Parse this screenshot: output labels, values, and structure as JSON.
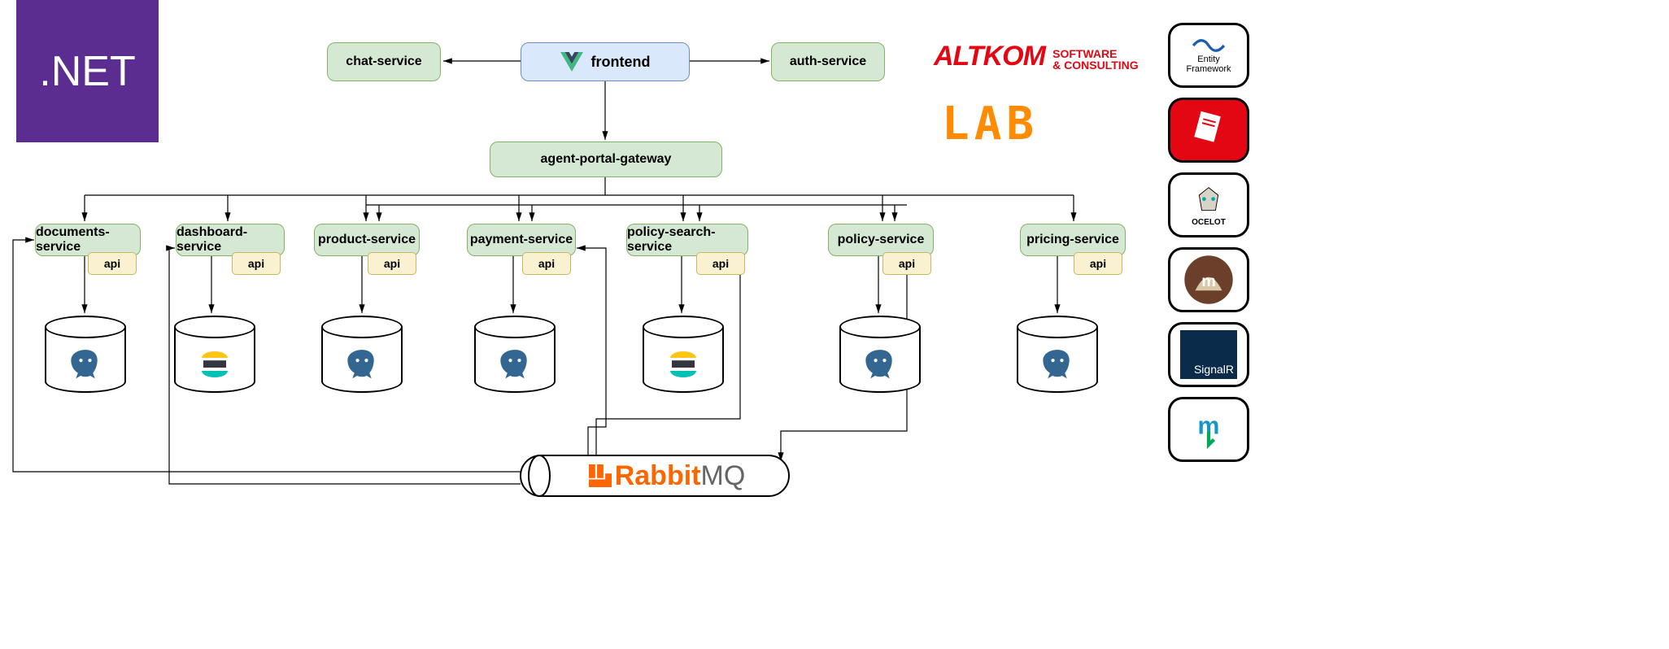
{
  "dotnet": ".NET",
  "top": {
    "chat": "chat-service",
    "frontend": "frontend",
    "auth": "auth-service"
  },
  "gateway": "agent-portal-gateway",
  "apiLabel": "api",
  "services": {
    "documents": "documents-service",
    "dashboard": "dashboard-service",
    "product": "product-service",
    "payment": "payment-service",
    "policySearch": "policy-search-service",
    "policy": "policy-service",
    "pricing": "pricing-service"
  },
  "rabbit": {
    "r": "Rabbit",
    "mq": "MQ"
  },
  "branding": {
    "altkom1": "ALTKOM",
    "altkom2a": "SOFTWARE",
    "altkom2b": "& CONSULTING",
    "lab": "LAB"
  },
  "tech": {
    "ef1": "Entity",
    "ef2": "Framework",
    "ocelot": "OCELOT",
    "signalr": "SignalR"
  }
}
